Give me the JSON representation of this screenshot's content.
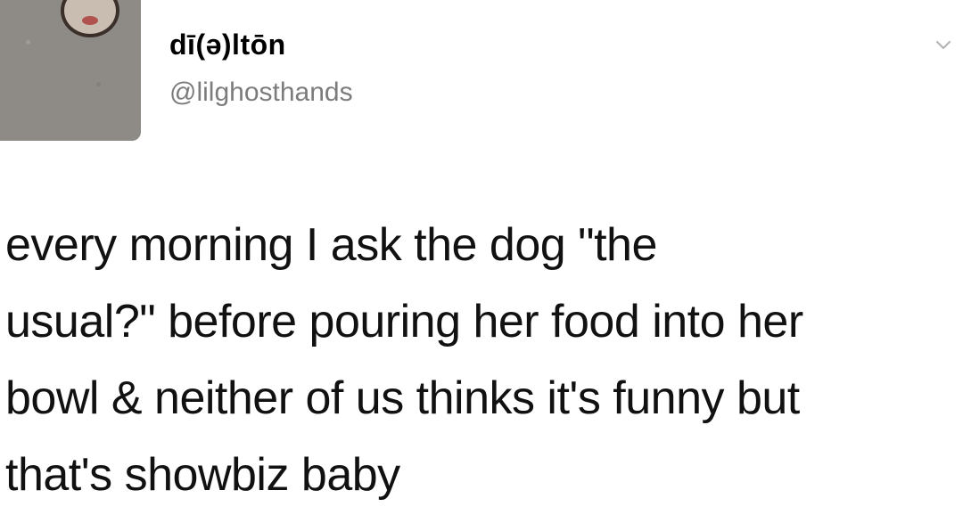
{
  "user": {
    "display_name": "dī(ə)ltōn",
    "handle": "@lilghosthands"
  },
  "icons": {
    "menu": "chevron-down-icon"
  },
  "tweet": {
    "lines": [
      "every morning I ask the dog \"the",
      "usual?\" before pouring her food into her",
      "bowl & neither of us thinks it's funny but",
      "that's showbiz baby"
    ]
  }
}
